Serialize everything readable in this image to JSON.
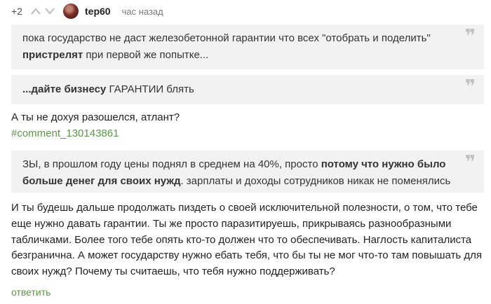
{
  "comment": {
    "rating": "+2",
    "username": "tep60",
    "time": "час назад",
    "quote1": {
      "text_a": "пока государство не даст железобетонной гарантии что всех \"отобрать и поделить\"",
      "bold_b": "пристрелят",
      "text_c": " при первой же попытке..."
    },
    "quote2": {
      "bold_a": "...дайте бизнесу",
      "text_b": " ГАРАНТИИ блять"
    },
    "line1": "А ты не дохуя разошелся, атлант?",
    "comment_link": "#comment_130143861",
    "quote3": {
      "text_a": "ЗЫ, в прошлом году цены поднял в среднем на 40%, просто ",
      "bold_b": "потому что нужно было больше денег для своих нужд",
      "text_c": ". зарплаты и доходы сотрудников никак не поменялись"
    },
    "body_text": "И ты будешь дальше продолжать пиздеть о своей исключительной полезности, о том, что тебе еще нужно давать гарантии. Ты же просто паразитируешь, прикрываясь разнообразными табличками. Более того тебе опять кто-то должен что то обеспечивать. Наглость капиталиста безгранична. А может государству нужно ебать тебя, что бы ты не мог что-то там повышать для своих нужд? Почему ты считаешь, что тебя нужно поддерживать?",
    "reply_label": "ответить",
    "quote_icon": "quote-mark-icon",
    "colors": {
      "link": "#5a9a46",
      "quote_bg": "#f2f2f2"
    }
  }
}
